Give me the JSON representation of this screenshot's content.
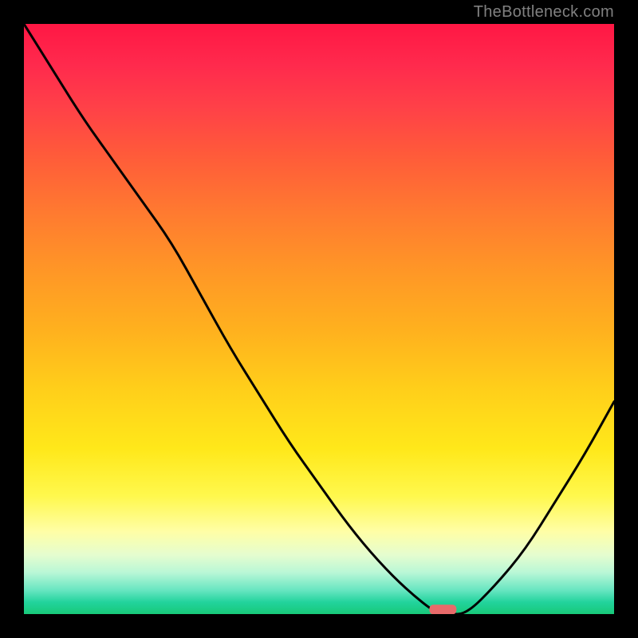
{
  "attribution": "TheBottleneck.com",
  "chart_data": {
    "type": "line",
    "title": "",
    "xlabel": "",
    "ylabel": "",
    "x": [
      0.0,
      0.05,
      0.1,
      0.15,
      0.2,
      0.25,
      0.3,
      0.35,
      0.4,
      0.45,
      0.5,
      0.55,
      0.6,
      0.65,
      0.7,
      0.72,
      0.75,
      0.8,
      0.85,
      0.9,
      0.95,
      1.0
    ],
    "values": [
      1.0,
      0.92,
      0.84,
      0.77,
      0.7,
      0.63,
      0.54,
      0.45,
      0.37,
      0.29,
      0.22,
      0.15,
      0.09,
      0.04,
      0.0,
      0.0,
      0.0,
      0.05,
      0.11,
      0.19,
      0.27,
      0.36
    ],
    "xlim": [
      0,
      1
    ],
    "ylim": [
      0,
      1
    ],
    "marker": {
      "x": 0.71,
      "y": 0.005,
      "color": "#e86a6a"
    },
    "gradient_stops": [
      {
        "pos": 0.0,
        "color": "#ff1744"
      },
      {
        "pos": 0.5,
        "color": "#ffb11e"
      },
      {
        "pos": 0.8,
        "color": "#fff84d"
      },
      {
        "pos": 1.0,
        "color": "#18c979"
      }
    ]
  }
}
